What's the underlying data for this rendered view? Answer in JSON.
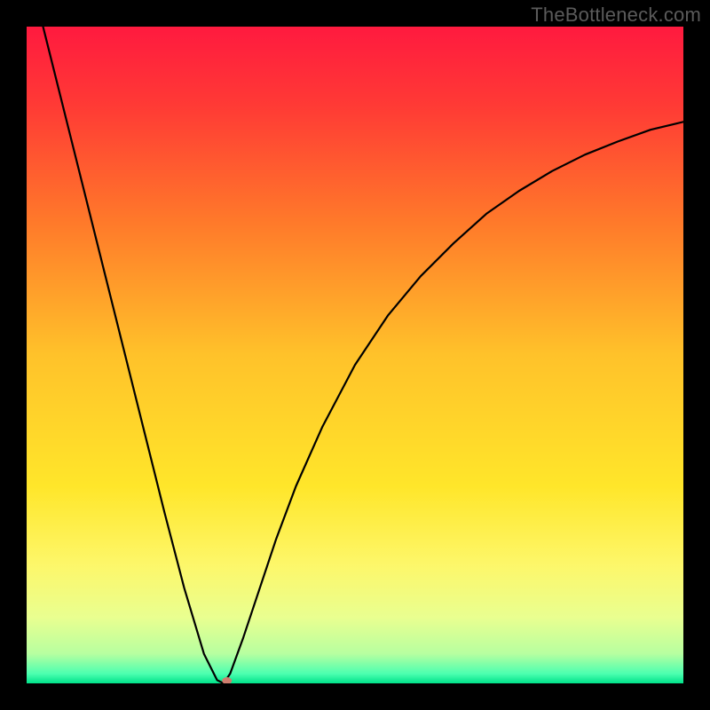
{
  "watermark": "TheBottleneck.com",
  "chart_data": {
    "type": "line",
    "title": "",
    "xlabel": "",
    "ylabel": "",
    "xlim": [
      0,
      100
    ],
    "ylim": [
      0,
      100
    ],
    "background_gradient": {
      "stops": [
        {
          "offset": 0.0,
          "color": "#ff1a3f"
        },
        {
          "offset": 0.12,
          "color": "#ff3a35"
        },
        {
          "offset": 0.3,
          "color": "#ff7a2a"
        },
        {
          "offset": 0.5,
          "color": "#ffc22a"
        },
        {
          "offset": 0.7,
          "color": "#ffe62a"
        },
        {
          "offset": 0.82,
          "color": "#fdf76a"
        },
        {
          "offset": 0.9,
          "color": "#e9ff90"
        },
        {
          "offset": 0.955,
          "color": "#b7ffa0"
        },
        {
          "offset": 0.985,
          "color": "#4dffb0"
        },
        {
          "offset": 1.0,
          "color": "#00e28a"
        }
      ]
    },
    "curve": {
      "x": [
        0,
        3,
        6,
        9,
        12,
        15,
        18,
        21,
        24,
        27,
        29,
        30,
        31,
        33,
        35,
        38,
        41,
        45,
        50,
        55,
        60,
        65,
        70,
        75,
        80,
        85,
        90,
        95,
        100
      ],
      "y": [
        110,
        98,
        86,
        74,
        62,
        50,
        38,
        26,
        14.5,
        4.5,
        0.5,
        0,
        1.5,
        7,
        13,
        22,
        30,
        39,
        48.5,
        56,
        62,
        67,
        71.5,
        75,
        78,
        80.5,
        82.5,
        84.3,
        85.5
      ]
    },
    "marker": {
      "x": 30.5,
      "y": 0.4,
      "color": "#cf7d6e",
      "rx": 5.5,
      "ry": 4
    }
  }
}
